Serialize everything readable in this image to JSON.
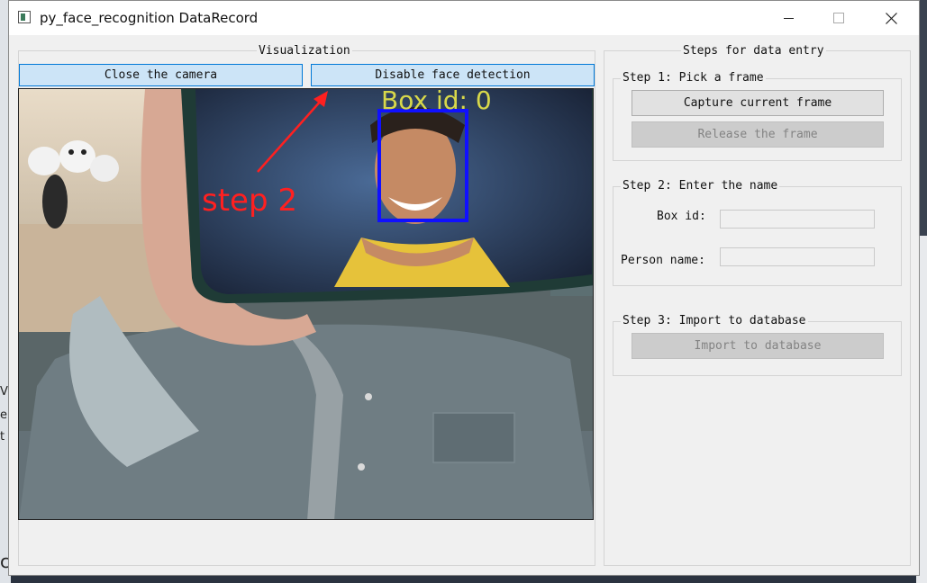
{
  "window": {
    "title": "py_face_recognition DataRecord",
    "icons": {
      "app": "app-window-icon",
      "minimize": "minimize-icon",
      "maximize": "maximize-icon",
      "close": "close-icon"
    }
  },
  "background_fragments": [
    "Vi",
    "e",
    "t",
    "c"
  ],
  "visualization": {
    "group_title": "Visualization",
    "close_camera_label": "Close the camera",
    "disable_detection_label": "Disable face detection",
    "overlay": {
      "box_label": "Box id: 0",
      "annotation_text": "step 2",
      "box_color": "#1010ff",
      "box_label_color": "#d8d84a",
      "annotation_color": "#ff2020"
    }
  },
  "steps": {
    "group_title": "Steps for data entry",
    "step1": {
      "title": "Step 1: Pick a frame",
      "capture_label": "Capture current frame",
      "release_label": "Release the frame"
    },
    "step2": {
      "title": "Step 2: Enter the name",
      "box_id_label": "Box id:",
      "box_id_value": "",
      "person_name_label": "Person name:",
      "person_name_value": ""
    },
    "step3": {
      "title": "Step 3: Import to database",
      "import_label": "Import to database"
    }
  },
  "colors": {
    "button_active_bg": "#cce4f7",
    "button_active_border": "#0078d7",
    "button_disabled_bg": "#cccccc",
    "window_bg": "#f0f0f0"
  }
}
